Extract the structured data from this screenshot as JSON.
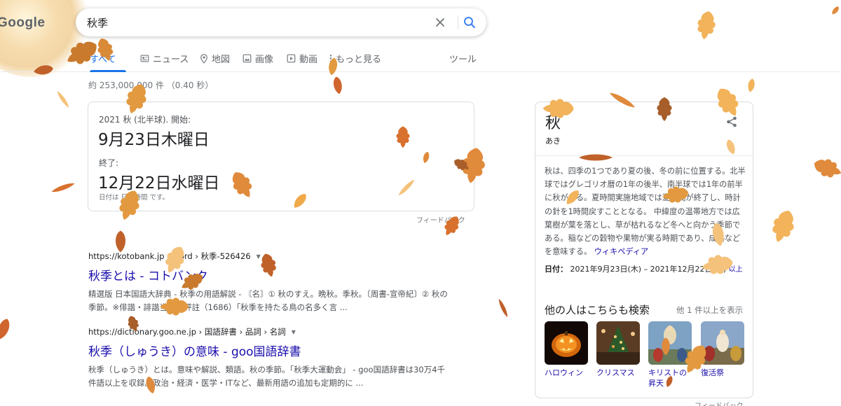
{
  "logo": {
    "text": "Google"
  },
  "search": {
    "query": "秋季"
  },
  "tabs": {
    "all": "すべて",
    "news": "ニュース",
    "maps": "地図",
    "images": "画像",
    "videos": "動画",
    "more": "もっと見る",
    "tools": "ツール"
  },
  "stats": "約 253,000,000 件 （0.40 秒）",
  "season_card": {
    "title": "2021 秋 (北半球). 開始:",
    "start_date": "9月23日木曜日",
    "end_label": "終了:",
    "end_date": "12月22日水曜日",
    "tz_note": "日付は 日本時間 です。",
    "feedback": "フィードバック"
  },
  "results": [
    {
      "url": "https://kotobank.jp › word › 秋季-526426",
      "title": "秋季とは - コトバンク",
      "snippet": "精選版 日本国語大辞典 - 秋季の用語解説 - 〘名〙① 秋のすえ。晩秋。季秋。〔周書-宣帝紀〕② 秋の季節。※俳諧・誹諧当世男評註（1686）「秋季を持たる鳥の名多く言 ..."
    },
    {
      "url": "https://dictionary.goo.ne.jp › 国語辞書 › 品詞 › 名詞",
      "title": "秋季（しゅうき）の意味 - goo国語辞書",
      "snippet": "秋季（しゅうき）とは。意味や解説、類語。秋の季節。「秋季大運動会」 - goo国語辞書は30万4千件語以上を収録。政治・経済・医学・ITなど、最新用語の追加も定期的に ..."
    }
  ],
  "knowledge_panel": {
    "title": "秋",
    "reading": "あき",
    "description": "秋は、四季の1つであり夏の後、冬の前に位置する。北半球ではグレゴリオ暦の1年の後半、南半球では1年の前半に秋がある。夏時間実施地域では夏時間が終了し、時計の針を1時間戻すこととなる。 中緯度の温帯地方では広葉樹が葉を落とし、草が枯れるなど冬へと向かう季節である。稲などの穀物や果物が実る時期であり、成熟などを意味する。",
    "wiki_link": "ウィキペディア",
    "date_label": "日付：",
    "date_value": "2021年9月23日(木) – 2021年12月22日(水)",
    "date_more": "以上",
    "related_heading": "他の人はこちらも検索",
    "related_more": "他 1 件以上を表示",
    "related": [
      {
        "label": "ハロウィン"
      },
      {
        "label": "クリスマス"
      },
      {
        "label": "キリストの昇天"
      },
      {
        "label": "復活祭"
      }
    ],
    "feedback": "フィードバック"
  },
  "colors": {
    "accent": "#1a73e8",
    "link": "#1a0dab",
    "leaf_light": "#f2b35a",
    "leaf_mid": "#e08a3c",
    "leaf_dark": "#b8632a"
  }
}
